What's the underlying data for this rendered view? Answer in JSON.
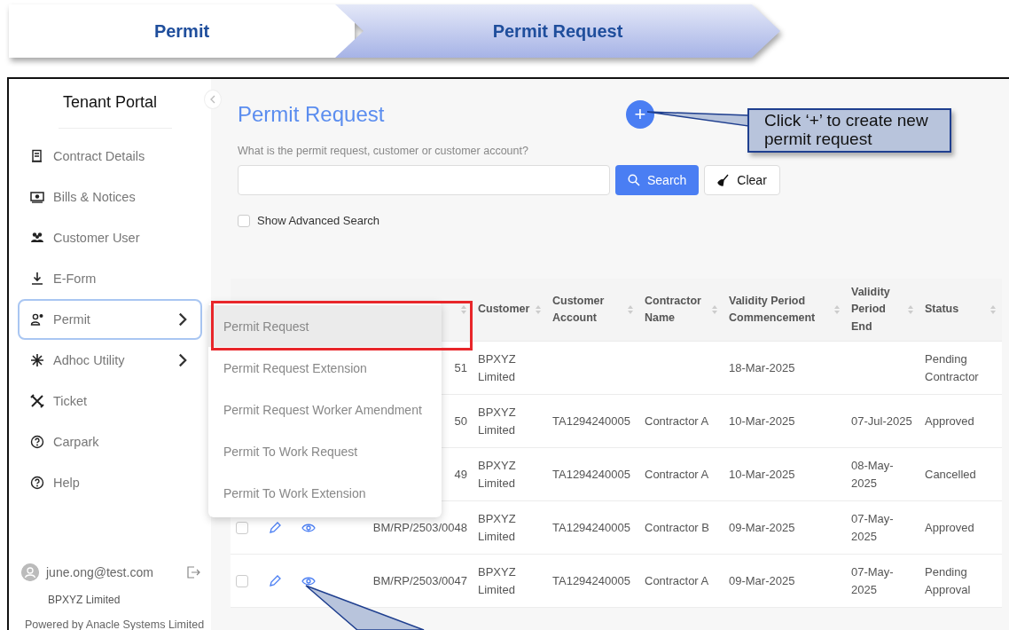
{
  "breadcrumb": [
    {
      "label": "Permit",
      "selected": false
    },
    {
      "label": "Permit Request",
      "selected": true
    }
  ],
  "sidebar": {
    "title": "Tenant Portal",
    "items": [
      {
        "label": "Contract Details",
        "submenu": false,
        "selected": false
      },
      {
        "label": "Bills & Notices",
        "submenu": false,
        "selected": false
      },
      {
        "label": "Customer User",
        "submenu": false,
        "selected": false
      },
      {
        "label": "E-Form",
        "submenu": false,
        "selected": false
      },
      {
        "label": "Permit",
        "submenu": true,
        "selected": true
      },
      {
        "label": "Adhoc Utility",
        "submenu": true,
        "selected": false
      },
      {
        "label": "Ticket",
        "submenu": false,
        "selected": false
      },
      {
        "label": "Carpark",
        "submenu": false,
        "selected": false
      },
      {
        "label": "Help",
        "submenu": false,
        "selected": false
      }
    ],
    "user": {
      "email": "june.ong@test.com",
      "company": "BPXYZ Limited"
    },
    "footer": "Powered by Anacle Systems Limited"
  },
  "main": {
    "title": "Permit Request",
    "add_button": "+",
    "search_label": "What is the permit request, customer or customer account?",
    "search_button": "Search",
    "clear_button": "Clear",
    "advanced_search": {
      "label": "Show Advanced Search",
      "checked": false
    }
  },
  "table": {
    "columns": [
      "Customer",
      "Customer Account",
      "Contractor Name",
      "Validity Period Commencement",
      "Validity Period End",
      "Status"
    ],
    "rows": [
      {
        "ref": "51",
        "customer": "BPXYZ Limited",
        "account": "",
        "contractor": "",
        "commencement": "18-Mar-2025",
        "end": "",
        "status": "Pending Contractor"
      },
      {
        "ref": "50",
        "customer": "BPXYZ Limited",
        "account": "TA1294240005",
        "contractor": "Contractor A",
        "commencement": "10-Mar-2025",
        "end": "07-Jul-2025",
        "status": "Approved"
      },
      {
        "ref": "49",
        "customer": "BPXYZ Limited",
        "account": "TA1294240005",
        "contractor": "Contractor A",
        "commencement": "10-Mar-2025",
        "end": "08-May-2025",
        "status": "Cancelled"
      },
      {
        "checked": false,
        "ref": "BM/RP/2503/0048",
        "customer": "BPXYZ Limited",
        "account": "TA1294240005",
        "contractor": "Contractor B",
        "commencement": "09-Mar-2025",
        "end": "07-May-2025",
        "status": "Approved"
      },
      {
        "checked": false,
        "ref": "BM/RP/2503/0047",
        "customer": "BPXYZ Limited",
        "account": "TA1294240005",
        "contractor": "Contractor A",
        "commencement": "09-Mar-2025",
        "end": "07-May-2025",
        "status": "Pending Approval"
      }
    ]
  },
  "dropdown": {
    "items": [
      {
        "label": "Permit Request",
        "selected": true
      },
      {
        "label": "Permit Request Extension",
        "selected": false
      },
      {
        "label": "Permit Request Worker Amendment",
        "selected": false
      },
      {
        "label": "Permit To Work Request",
        "selected": false
      },
      {
        "label": "Permit To Work Extension",
        "selected": false
      }
    ]
  },
  "callout": {
    "text": "Click ‘+’ to create new permit request"
  }
}
